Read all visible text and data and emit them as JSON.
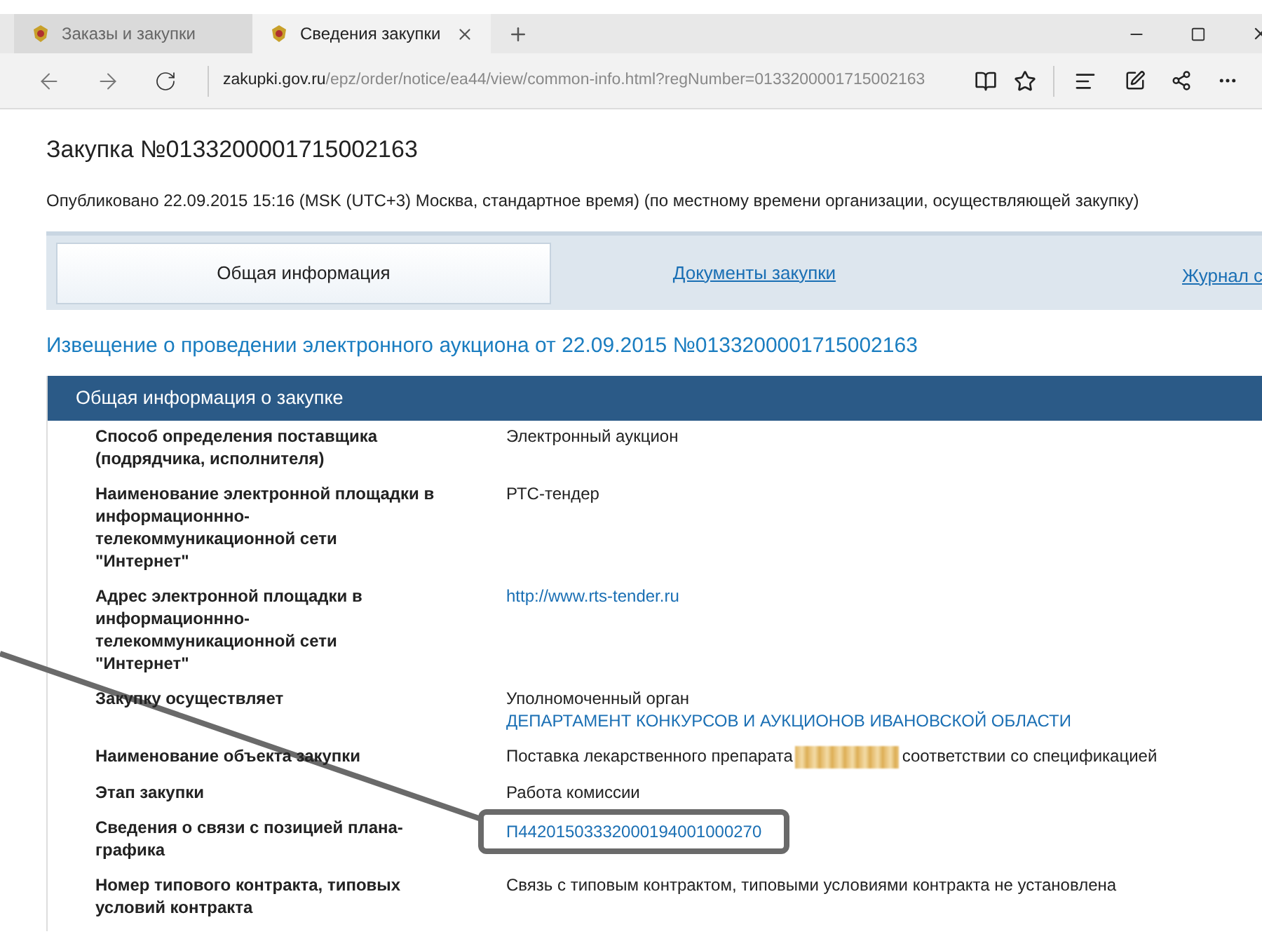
{
  "browser": {
    "tabs": [
      {
        "label": "Заказы и закупки",
        "selected": false
      },
      {
        "label": "Сведения закупки",
        "selected": true
      }
    ],
    "address": {
      "domain": "zakupki.gov.ru",
      "path": "/epz/order/notice/ea44/view/common-info.html?regNumber=0133200001715002163"
    }
  },
  "page": {
    "title": "Закупка №0133200001715002163",
    "published": "Опубликовано 22.09.2015 15:16 (MSK (UTC+3) Москва, стандартное время) (по местному времени организации, осуществляющей закупку)",
    "tabs": [
      {
        "label": "Общая информация",
        "selected": true
      },
      {
        "label": "Документы закупки",
        "selected": false
      },
      {
        "label": "Журнал с",
        "selected": false
      }
    ],
    "notice_heading": "Извещение о проведении электронного аукциона от 22.09.2015 №0133200001715002163",
    "section_title": "Общая информация о закупке",
    "rows": [
      {
        "label": "Способ определения поставщика (подрядчика, исполнителя)",
        "highlighted": false,
        "lines": [
          [
            {
              "kind": "text",
              "text": "Электронный аукцион"
            }
          ]
        ]
      },
      {
        "label": "Наименование электронной площадки в информационнно-телекоммуникационной сети \"Интернет\"",
        "highlighted": false,
        "lines": [
          [
            {
              "kind": "text",
              "text": "РТС-тендер"
            }
          ]
        ]
      },
      {
        "label": "Адрес электронной площадки в информационнно-телекоммуникационной сети \"Интернет\"",
        "highlighted": false,
        "lines": [
          [
            {
              "kind": "link",
              "text": "http://www.rts-tender.ru"
            }
          ]
        ]
      },
      {
        "label": "Закупку осуществляет",
        "highlighted": false,
        "lines": [
          [
            {
              "kind": "text",
              "text": "Уполномоченный орган"
            }
          ],
          [
            {
              "kind": "link",
              "text": "ДЕПАРТАМЕНТ КОНКУРСОВ И АУКЦИОНОВ ИВАНОВСКОЙ ОБЛАСТИ"
            }
          ]
        ]
      },
      {
        "label": "Наименование объекта закупки",
        "highlighted": false,
        "lines": [
          [
            {
              "kind": "text",
              "text": "Поставка лекарственного препарата"
            },
            {
              "kind": "redacted"
            },
            {
              "kind": "text",
              "text": "соответствии со спецификацией"
            }
          ]
        ]
      },
      {
        "label": "Этап закупки",
        "highlighted": false,
        "lines": [
          [
            {
              "kind": "text",
              "text": "Работа комиссии"
            }
          ]
        ]
      },
      {
        "label": "Сведения о связи с позицией плана-графика",
        "highlighted": true,
        "lines": [
          [
            {
              "kind": "link",
              "text": "П44201503332000194001000270"
            }
          ]
        ]
      },
      {
        "label": "Номер типового контракта, типовых условий контракта",
        "highlighted": false,
        "lines": [
          [
            {
              "kind": "text",
              "text": "Связь с типовым контрактом, типовыми условиями контракта не установлена"
            }
          ]
        ]
      }
    ]
  }
}
